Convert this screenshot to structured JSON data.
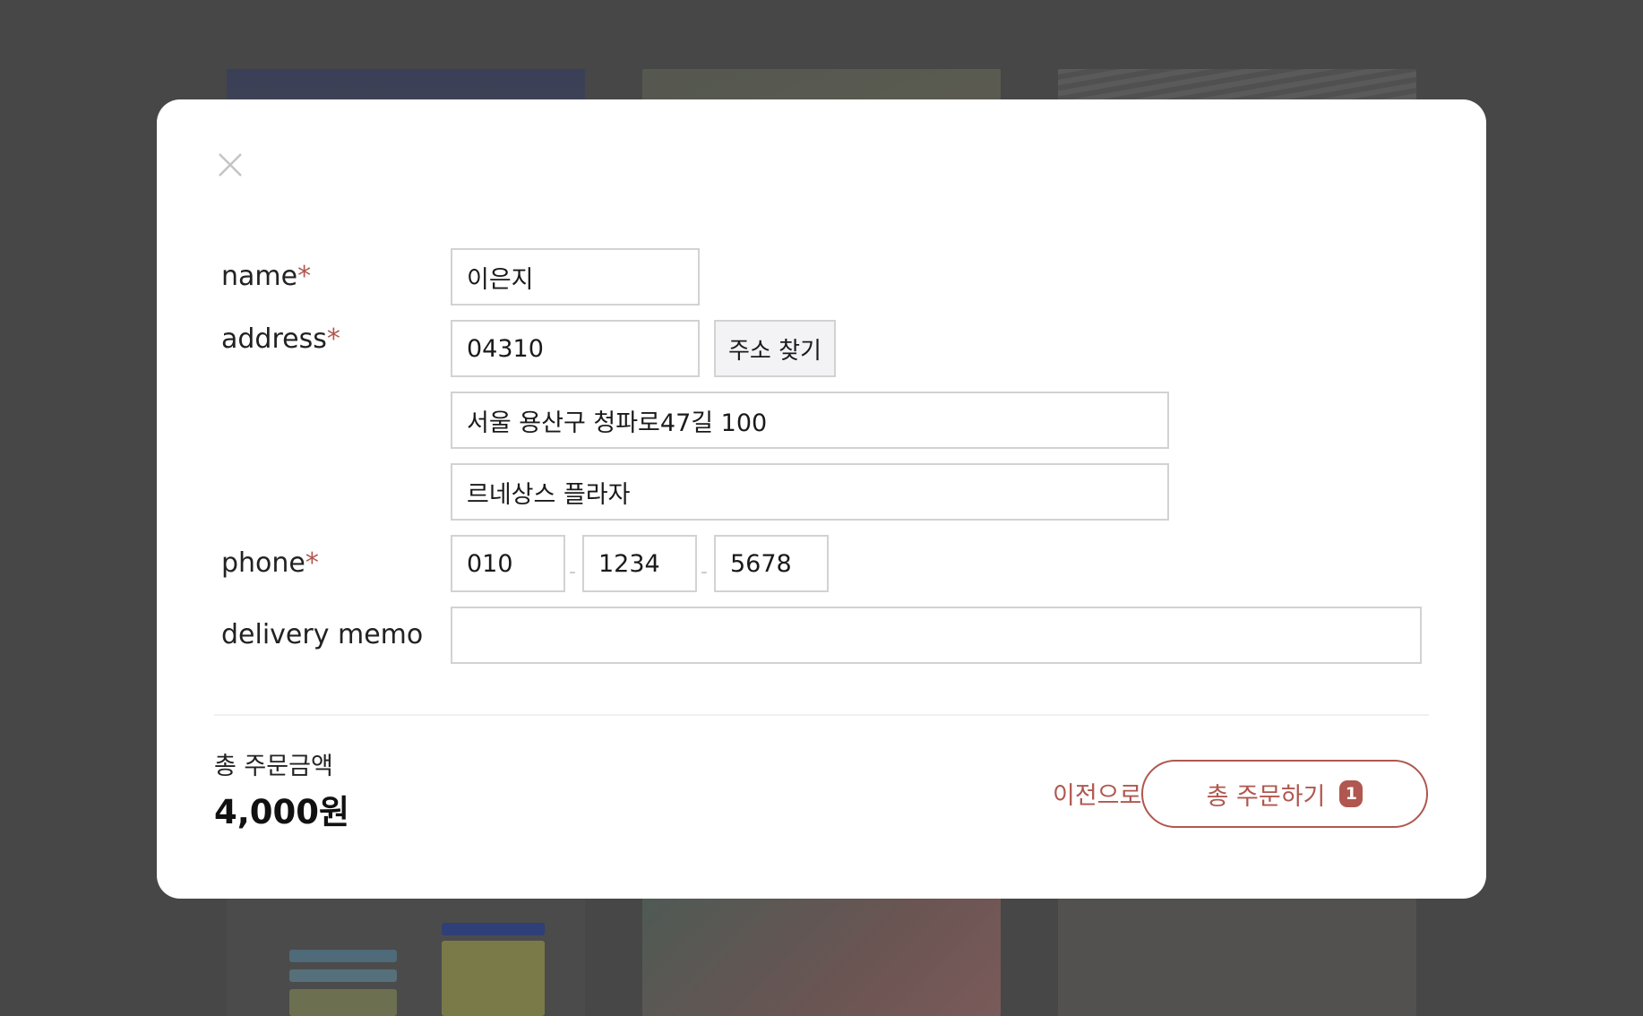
{
  "form": {
    "name_label": "name",
    "address_label": "address",
    "phone_label": "phone",
    "memo_label": "delivery memo",
    "required_mark": "*",
    "name_value": "이은지",
    "zipcode_value": "04310",
    "find_address_label": "주소 찾기",
    "address1_value": "서울 용산구 청파로47길 100",
    "address2_value": "르네상스 플라자",
    "phone1_value": "010",
    "phone2_value": "1234",
    "phone3_value": "5678",
    "phone_separator": "-",
    "memo_value": ""
  },
  "footer": {
    "total_label": "총 주문금액",
    "total_amount": "4,000원",
    "back_label": "이전으로",
    "order_label": "총 주문하기",
    "order_count": "1"
  },
  "colors": {
    "accent": "#b0574f",
    "overlay": "#474747",
    "border": "#d2d2d2"
  },
  "icons": {
    "close": "close-icon"
  }
}
